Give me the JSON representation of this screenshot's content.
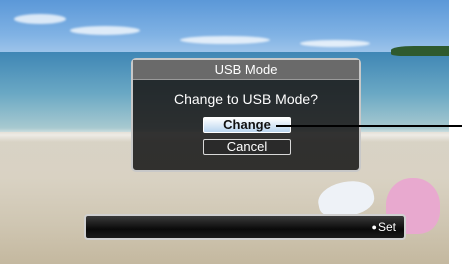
{
  "dialog": {
    "title": "USB Mode",
    "message": "Change to USB Mode?",
    "change_button": "Change",
    "cancel_button": "Cancel"
  },
  "status_bar": {
    "bullet": "●",
    "hint": "Set"
  }
}
